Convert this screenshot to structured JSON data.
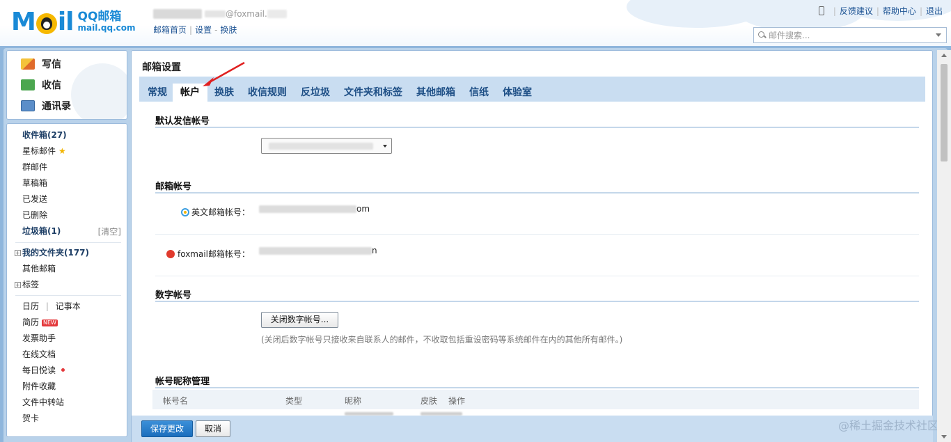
{
  "header": {
    "logo_main": "M",
    "logo_tail": "il",
    "brand_line1": "QQ邮箱",
    "brand_line2": "mail.qq.com",
    "account_email_suffix": "@foxmail.",
    "nav_links": [
      "邮箱首页",
      "设置",
      "换肤"
    ],
    "top_right_links": [
      "反馈建议",
      "帮助中心",
      "退出"
    ],
    "search_placeholder": "邮件搜索..."
  },
  "sidebar": {
    "actions": [
      {
        "label": "写信",
        "icon": "compose-icon"
      },
      {
        "label": "收信",
        "icon": "inbox-download-icon"
      },
      {
        "label": "通讯录",
        "icon": "contacts-icon"
      }
    ],
    "folders": {
      "inbox": "收件箱(27)",
      "starred": "星标邮件",
      "group": "群邮件",
      "drafts": "草稿箱",
      "sent": "已发送",
      "deleted": "已删除",
      "spam": "垃圾箱(1)",
      "spam_clear": "[清空]",
      "my_folders": "我的文件夹(177)",
      "other_mailbox": "其他邮箱",
      "tags": "标签"
    },
    "tools": {
      "calendar": "日历",
      "notebook": "记事本",
      "resume": "简历",
      "resume_badge": "NEW",
      "invoice": "发票助手",
      "online_docs": "在线文档",
      "daily_read": "每日悦读",
      "attachments": "附件收藏",
      "file_transfer": "文件中转站",
      "card": "贺卡"
    }
  },
  "settings": {
    "title": "邮箱设置",
    "tabs": [
      "常规",
      "帐户",
      "换肤",
      "收信规则",
      "反垃圾",
      "文件夹和标签",
      "其他邮箱",
      "信纸",
      "体验室"
    ],
    "active_tab": "帐户",
    "section_default_sender": "默认发信帐号",
    "section_mail_accounts": "邮箱帐号",
    "english_account_label": "英文邮箱帐号：",
    "english_account_value_suffix": "om",
    "foxmail_account_label": "foxmail邮箱帐号：",
    "foxmail_account_value_suffix": "n",
    "section_numeric": "数字帐号",
    "close_numeric_button": "关闭数字帐号...",
    "numeric_hint": "(关闭后数字帐号只接收来自联系人的邮件，不收取包括重设密码等系统邮件在内的其他所有邮件。)",
    "section_nickname": "帐号昵称管理",
    "table_headers": [
      "帐号名",
      "类型",
      "昵称",
      "皮肤",
      "操作"
    ]
  },
  "footer": {
    "save_button": "保存更改",
    "cancel_button": "取消",
    "watermark": "@稀土掘金技术社区"
  },
  "colors": {
    "brand_blue": "#1a8ad6",
    "tab_bar": "#c9ddf1",
    "primary_button": "#1b6ebd"
  }
}
